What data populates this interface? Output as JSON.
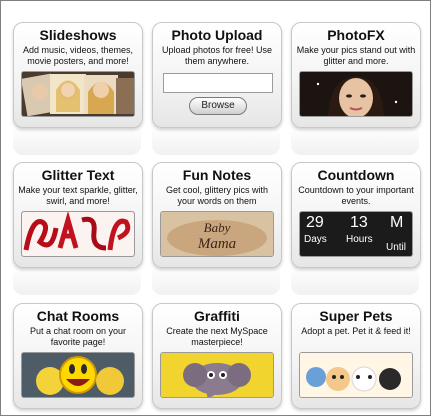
{
  "cards": [
    {
      "title": "Slideshows",
      "description": "Add music, videos, themes, movie posters, and more!",
      "thumb_icon": "slideshow-photos-icon"
    },
    {
      "title": "Photo Upload",
      "description": "Upload photos for free! Use them anywhere.",
      "button_label": "Browse",
      "field_value": ""
    },
    {
      "title": "PhotoFX",
      "description": "Make your pics stand out with glitter and more.",
      "thumb_icon": "portrait-photo-icon"
    },
    {
      "title": "Glitter Text",
      "description": "Make your text sparkle, glitter, swirl, and more!",
      "thumb_icon": "glitter-text-icon"
    },
    {
      "title": "Fun Notes",
      "description": "Get cool, glittery pics with your words on them",
      "thumb_icon": "fun-note-icon",
      "note_text": "Baby Mama"
    },
    {
      "title": "Countdown",
      "description": "Countdown to your important events.",
      "thumb_icon": "countdown-clock-icon",
      "countdown": {
        "days": "29",
        "days_label": "Days",
        "hours": "13",
        "hours_label": "Hours",
        "min_label": "M",
        "until_label": "Until"
      }
    },
    {
      "title": "Chat Rooms",
      "description": "Put a chat room on your favorite page!",
      "thumb_icon": "smiley-chat-icon"
    },
    {
      "title": "Graffiti",
      "description": "Create the next MySpace masterpiece!",
      "thumb_icon": "elephant-graffiti-icon"
    },
    {
      "title": "Super Pets",
      "description": "Adopt a pet. Pet it & feed it!",
      "thumb_icon": "cartoon-pets-icon"
    }
  ]
}
